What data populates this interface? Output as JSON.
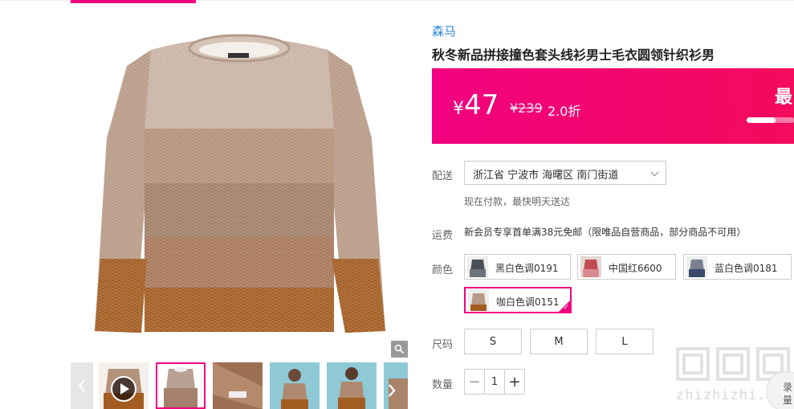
{
  "product": {
    "brand": "森马",
    "title": "秋冬新品拼接撞色套头线衫男士毛衣圆领针织衫男",
    "price": {
      "currency": "¥",
      "current": "47",
      "original": "¥239",
      "discount": "2.0折"
    },
    "promo_tag": "最",
    "promo_progress": 0.6
  },
  "delivery": {
    "label": "配送",
    "location": "浙江省 宁波市 海曙区 南门街道",
    "note": "现在付款，最快明天送达"
  },
  "shipping": {
    "label": "运费",
    "text": "新会员专享首单满38元免邮（限唯品自营商品，部分商品不可用）"
  },
  "colors": {
    "label": "颜色",
    "options": [
      {
        "name": "黑白色调0191",
        "selected": false
      },
      {
        "name": "中国红6600",
        "selected": false
      },
      {
        "name": "蓝白色调0181",
        "selected": false
      },
      {
        "name": "咖白色调0151",
        "selected": true
      }
    ]
  },
  "sizes": {
    "label": "尺码",
    "options": [
      "S",
      "M",
      "L"
    ]
  },
  "quantity": {
    "label": "数量",
    "value": "1",
    "minus": "−",
    "plus": "+"
  },
  "watermark": {
    "text": "zhizhizhi.com",
    "badge_lines": [
      "录",
      "量"
    ]
  },
  "colors_hex": {
    "accent": "#f10180",
    "brand_link": "#2c85d6"
  }
}
